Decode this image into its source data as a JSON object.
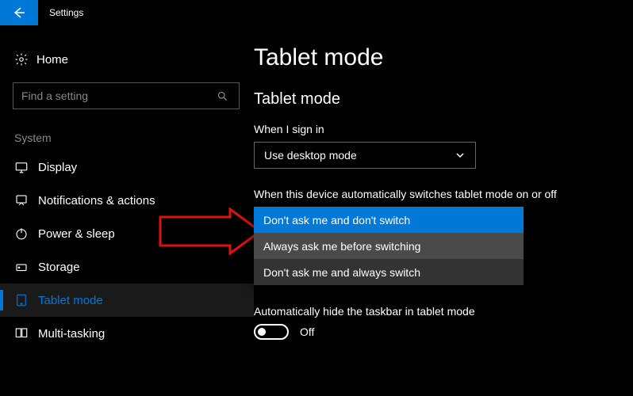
{
  "titlebar": {
    "label": "Settings"
  },
  "sidebar": {
    "home_label": "Home",
    "search_placeholder": "Find a setting",
    "section_label": "System",
    "items": [
      {
        "label": "Display"
      },
      {
        "label": "Notifications & actions"
      },
      {
        "label": "Power & sleep"
      },
      {
        "label": "Storage"
      },
      {
        "label": "Tablet mode"
      },
      {
        "label": "Multi-tasking"
      }
    ]
  },
  "main": {
    "page_title": "Tablet mode",
    "section_title": "Tablet mode",
    "signin_label": "When I sign in",
    "signin_value": "Use desktop mode",
    "switch_label": "When this device automatically switches tablet mode on or off",
    "switch_options": [
      "Don't ask me and don't switch",
      "Always ask me before switching",
      "Don't ask me and always switch"
    ],
    "hide_taskbar_label": "Automatically hide the taskbar in tablet mode",
    "hide_taskbar_value": "Off"
  }
}
